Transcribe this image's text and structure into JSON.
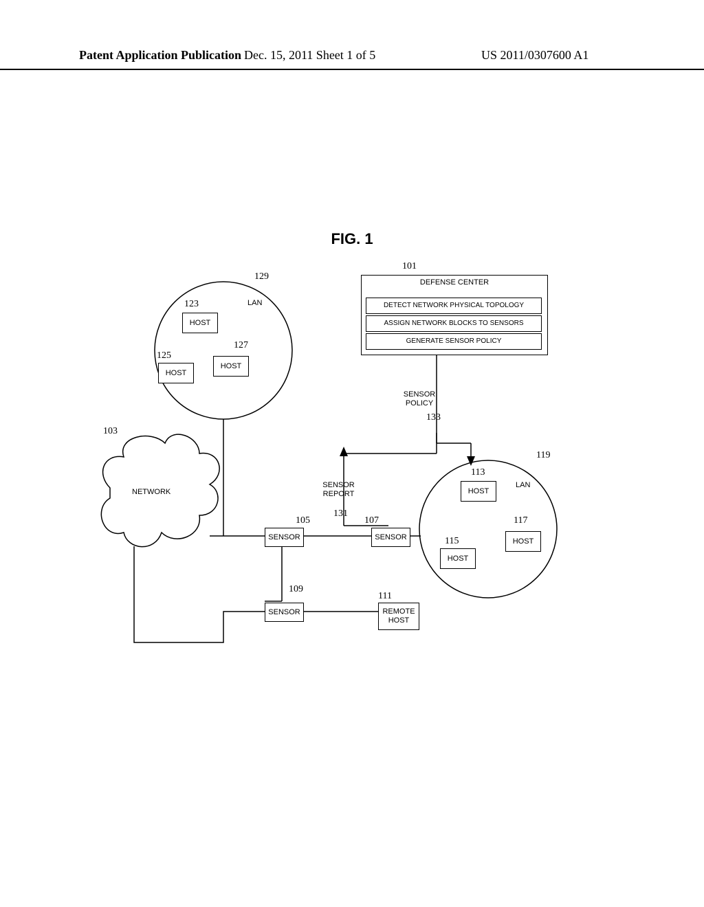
{
  "header": {
    "left": "Patent Application Publication",
    "center": "Dec. 15, 2011  Sheet 1 of 5",
    "right": "US 2011/0307600 A1"
  },
  "figure": {
    "title": "FIG. 1"
  },
  "refs": {
    "r101": "101",
    "r103": "103",
    "r105": "105",
    "r107": "107",
    "r109": "109",
    "r111": "111",
    "r113": "113",
    "r115": "115",
    "r117": "117",
    "r119": "119",
    "r123": "123",
    "r125": "125",
    "r127": "127",
    "r129": "129",
    "r131": "131",
    "r133": "133"
  },
  "labels": {
    "defense_center_title": "DEFENSE\nCENTER",
    "dc_row1": "DETECT NETWORK PHYSICAL TOPOLOGY",
    "dc_row2": "ASSIGN NETWORK BLOCKS TO SENSORS",
    "dc_row3": "GENERATE SENSOR POLICY",
    "sensor_policy": "SENSOR\nPOLICY",
    "sensor_report": "SENSOR\nREPORT",
    "lan": "LAN",
    "host": "HOST",
    "network": "NETWORK",
    "sensor": "SENSOR",
    "remote_host": "REMOTE\nHOST"
  }
}
